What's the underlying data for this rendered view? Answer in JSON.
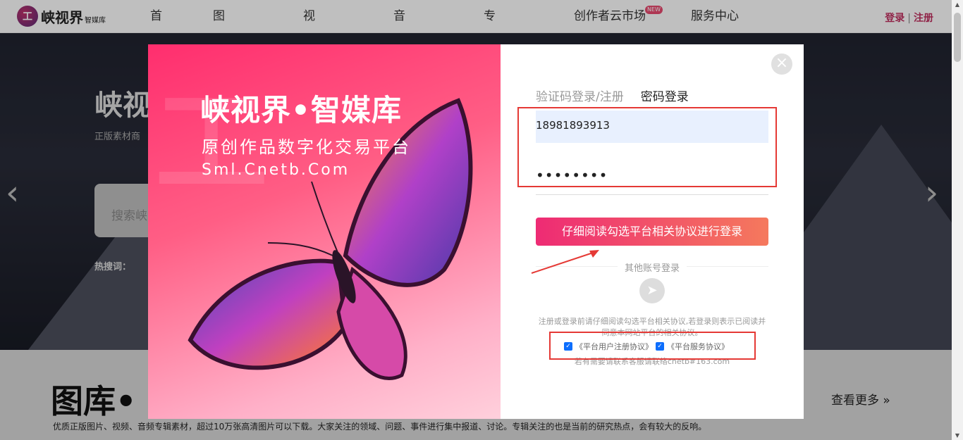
{
  "header": {
    "logo_text": "峡视界",
    "logo_sub": "智媒库",
    "logo_mark": "工",
    "nav": [
      {
        "label": "首页"
      },
      {
        "label": "图片素材"
      },
      {
        "label": "视频素材"
      },
      {
        "label": "音乐素材"
      },
      {
        "label": "专辑视界"
      },
      {
        "label": "创作者云市场",
        "badge": "NEW"
      },
      {
        "label": "服务中心"
      }
    ],
    "login": "登录",
    "register": "注册"
  },
  "hero": {
    "title": "峡视",
    "subtitle": "正版素材商",
    "search_placeholder": "搜索峡",
    "hot_label": "热搜词："
  },
  "section": {
    "title": "图库•",
    "more": "查看更多",
    "description": "优质正版图片、视频、音频专辑素材，超过10万张高清图片可以下载。大家关注的领域、问题、事件进行集中报道、讨论。专辑关注的也是当前的研究热点，会有较大的反响。"
  },
  "modal": {
    "brand_title": "峡视界•智媒库",
    "brand_sub": "原创作品数字化交易平台",
    "brand_url": "Sml.Cnetb.Com",
    "tabs": [
      "验证码登录/注册",
      "密码登录"
    ],
    "phone_value": "18981893913",
    "password_mask": "••••••••",
    "login_button": "仔细阅读勾选平台相关协议进行登录",
    "other_login": "其他账号登录",
    "notice": "注册或登录前请仔细阅读勾选平台相关协议,若登录则表示已阅读并同意本网站平台的相关协议。",
    "agreement_user": "《平台用户注册协议》",
    "agreement_service": "《平台服务协议》",
    "contact": "若有需要请联系客服请联络cnetb#163.com"
  },
  "colors": {
    "accent": "#ee2b74",
    "annotation": "#e53935"
  }
}
